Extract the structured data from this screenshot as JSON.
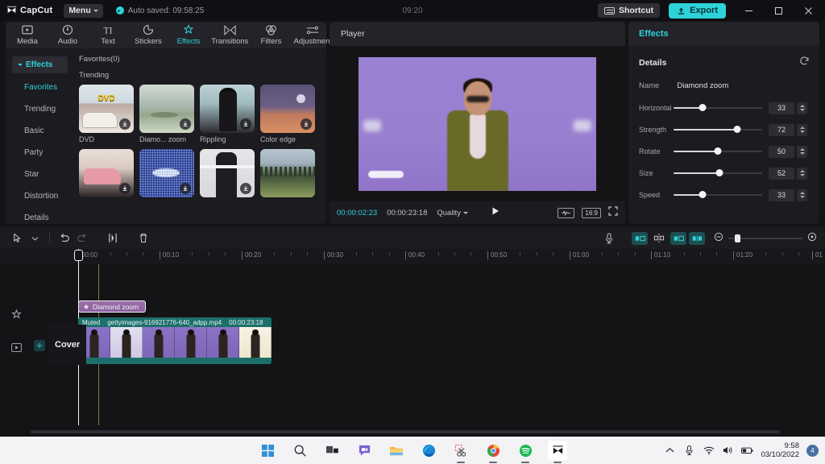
{
  "titlebar": {
    "app_name": "CapCut",
    "menu_label": "Menu",
    "autosave_text": "Auto saved: 09:58:25",
    "center_time": "09:20",
    "shortcut_label": "Shortcut",
    "export_label": "Export",
    "minimize_icon": "minimize-icon",
    "maximize_icon": "maximize-icon",
    "close_icon": "close-icon"
  },
  "tabs": [
    {
      "label": "Media",
      "icon": "media-icon",
      "active": false
    },
    {
      "label": "Audio",
      "icon": "audio-icon",
      "active": false
    },
    {
      "label": "Text",
      "icon": "text-icon",
      "active": false
    },
    {
      "label": "Stickers",
      "icon": "stickers-icon",
      "active": false
    },
    {
      "label": "Effects",
      "icon": "effects-icon",
      "active": true
    },
    {
      "label": "Transitions",
      "icon": "transitions-icon",
      "active": false
    },
    {
      "label": "Filters",
      "icon": "filters-icon",
      "active": false
    },
    {
      "label": "Adjustment",
      "icon": "adjustment-icon",
      "active": false
    }
  ],
  "sidenav": {
    "header": "Effects",
    "items": [
      {
        "label": "Favorites",
        "active": true
      },
      {
        "label": "Trending",
        "active": false
      },
      {
        "label": "Basic",
        "active": false
      },
      {
        "label": "Party",
        "active": false
      },
      {
        "label": "Star",
        "active": false
      },
      {
        "label": "Distortion",
        "active": false
      },
      {
        "label": "Details",
        "active": false
      }
    ]
  },
  "effects_browser": {
    "favorites_title": "Favorites(0)",
    "trending_title": "Trending",
    "items": [
      {
        "label": "DVD",
        "art": "th-dvd",
        "download": true
      },
      {
        "label": "Diamo... zoom",
        "art": "th-dia",
        "download": true
      },
      {
        "label": "Rippling",
        "art": "th-rip",
        "download": true
      },
      {
        "label": "Color edge",
        "art": "th-edge",
        "download": true
      },
      {
        "label": "",
        "art": "th-pink",
        "download": true
      },
      {
        "label": "",
        "art": "th-dot",
        "download": true
      },
      {
        "label": "",
        "art": "th-glt",
        "download": true
      },
      {
        "label": "",
        "art": "th-for",
        "download": false
      }
    ]
  },
  "player": {
    "title": "Player",
    "current_time": "00:00:02:23",
    "total_time": "00:00:23:18",
    "quality_label": "Quality",
    "play_icon": "play-icon",
    "waveform_label": "⌇",
    "aspect_ratio": "16:9",
    "fullscreen_icon": "fullscreen-icon"
  },
  "right_panel": {
    "header": "Effects",
    "section_title": "Details",
    "reset_icon": "reset-icon",
    "name_label": "Name",
    "name_value": "Diamond zoom",
    "sliders": [
      {
        "label": "Horizontal",
        "value": 33
      },
      {
        "label": "Strength",
        "value": 72
      },
      {
        "label": "Rotate",
        "value": 50
      },
      {
        "label": "Size",
        "value": 52
      },
      {
        "label": "Speed",
        "value": 33
      }
    ]
  },
  "timeline_toolbar": {
    "left_tools": [
      {
        "name": "select-arrow-icon",
        "dim": false
      },
      {
        "name": "tool-dropdown-icon",
        "dim": false
      },
      {
        "name": "undo-icon",
        "dim": false
      },
      {
        "name": "redo-icon",
        "dim": true
      },
      {
        "name": "split-icon",
        "dim": false
      },
      {
        "name": "delete-icon",
        "dim": false
      }
    ],
    "right_tools": [
      {
        "name": "microphone-icon",
        "teal": false
      },
      {
        "name": "crop-icon",
        "teal": true
      },
      {
        "name": "mirror-icon",
        "teal": false
      },
      {
        "name": "freeze-icon",
        "teal": true
      },
      {
        "name": "mix-icon",
        "teal": true
      }
    ],
    "zoom_out_icon": "zoom-out-icon",
    "zoom_in_icon": "zoom-in-icon"
  },
  "timeline": {
    "ruler_labels": [
      "00:00",
      "00:10",
      "00:20",
      "00:30",
      "00:40",
      "00:50",
      "01:00",
      "01:10",
      "01:20",
      "01"
    ],
    "effect_track_icon": "effects-track-icon",
    "video_track_icon": "video-track-icon",
    "effect_clip": {
      "label": "Diamond zoom",
      "icon": "effect-clip-icon"
    },
    "video_clip": {
      "muted_label": "Muted",
      "filename": "gettyimages-916921776-640_adpp.mp4",
      "duration": "00:00:23:18"
    },
    "cover_label": "Cover"
  },
  "taskbar": {
    "apps": [
      {
        "name": "start-icon",
        "running": false
      },
      {
        "name": "search-icon",
        "running": false
      },
      {
        "name": "task-view-icon",
        "running": false
      },
      {
        "name": "chat-icon",
        "running": false
      },
      {
        "name": "file-explorer-icon",
        "running": false
      },
      {
        "name": "edge-icon",
        "running": false
      },
      {
        "name": "snipping-tool-icon",
        "running": true
      },
      {
        "name": "chrome-icon",
        "running": true
      },
      {
        "name": "spotify-icon",
        "running": true
      },
      {
        "name": "capcut-icon",
        "running": true
      }
    ],
    "tray": [
      {
        "name": "show-hidden-icons-icon"
      },
      {
        "name": "microphone-icon"
      },
      {
        "name": "wifi-icon"
      },
      {
        "name": "volume-icon"
      },
      {
        "name": "battery-icon"
      }
    ],
    "time": "9:58",
    "date": "03/10/2022",
    "notification_count": "4"
  },
  "colors": {
    "accent": "#2ed3d9",
    "panel": "#1b1b20",
    "titlebar": "#101014",
    "clip_video": "#1c6f6a",
    "clip_effect": "#9b6fa8"
  }
}
